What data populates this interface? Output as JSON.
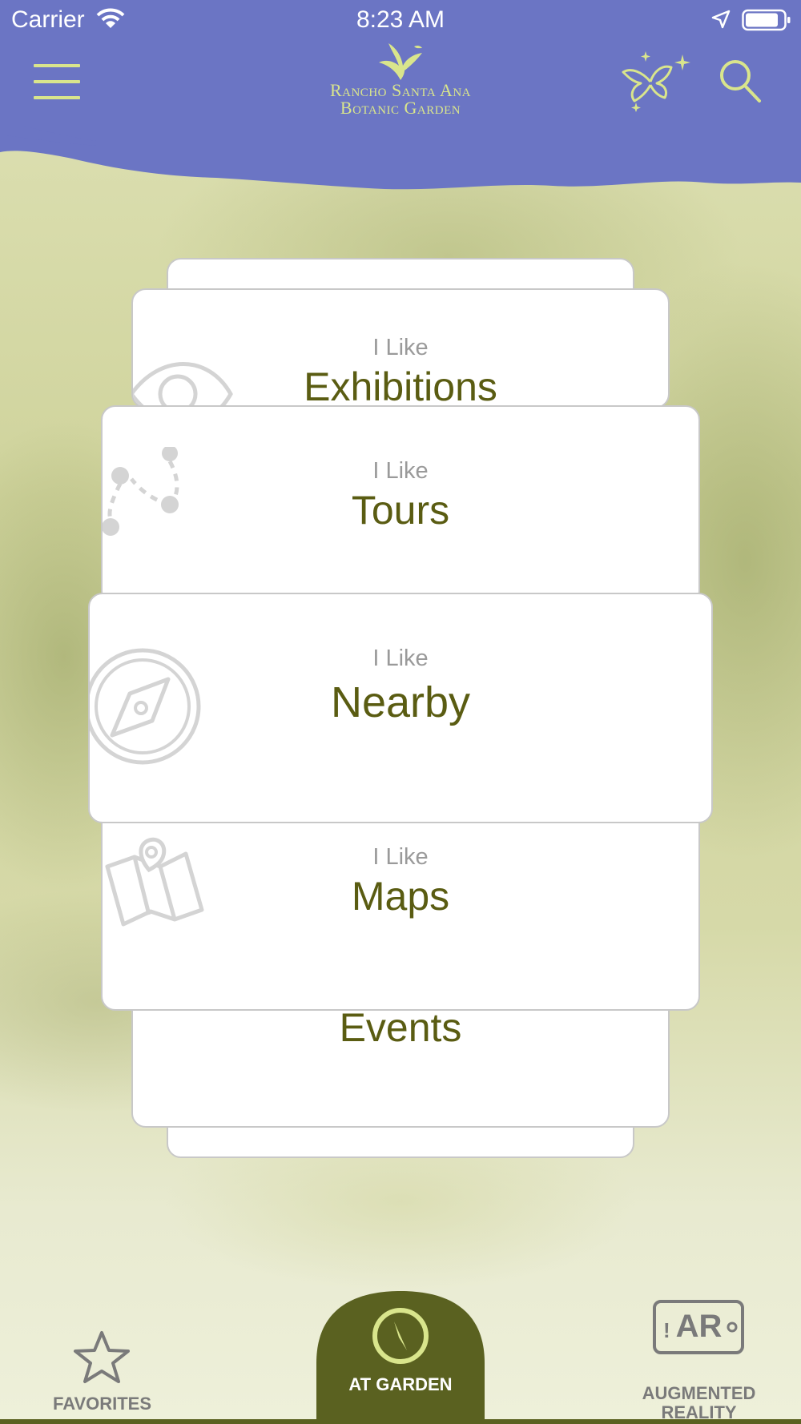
{
  "status_bar": {
    "carrier": "Carrier",
    "time": "8:23 AM"
  },
  "header": {
    "logo_line1": "Rancho Santa Ana",
    "logo_line2": "Botanic Garden",
    "icons": [
      "menu-icon",
      "butterfly-sparkle-icon",
      "search-icon"
    ]
  },
  "cards": [
    {
      "prefix": "I Like",
      "title": "Exhibitions",
      "icon": "eye-icon"
    },
    {
      "prefix": "I Like",
      "title": "Tours",
      "icon": "route-icon"
    },
    {
      "prefix": "I Like",
      "title": "Nearby",
      "icon": "compass-icon"
    },
    {
      "prefix": "I Like",
      "title": "Maps",
      "icon": "map-pin-icon"
    },
    {
      "prefix": "",
      "title": "Events",
      "icon": "ticket-icon"
    }
  ],
  "tabbar": {
    "favorites_label": "FAVORITES",
    "garden_label": "AT GARDEN",
    "ar_badge": "AR",
    "ar_label_line1": "AUGMENTED",
    "ar_label_line2": "REALITY"
  },
  "colors": {
    "header": "#6b75c4",
    "accent_light": "#d9e58c",
    "title_olive": "#5a5c12",
    "tab_active": "#5a6120"
  }
}
